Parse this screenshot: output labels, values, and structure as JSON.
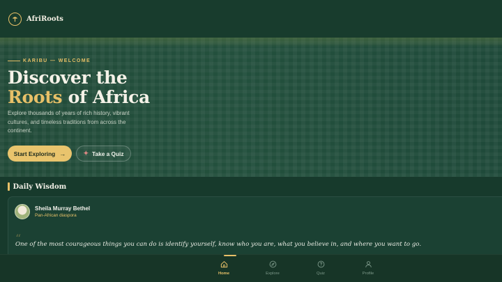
{
  "header": {
    "brand": "AfriRoots",
    "logo_icon": "tree-icon"
  },
  "hero": {
    "eyebrow": "KARIBU — WELCOME",
    "title_line1": "Discover the",
    "title_accent": "Roots",
    "title_rest": " of Africa",
    "subtitle": "Explore thousands of years of rich history, vibrant cultures, and timeless traditions from across the continent.",
    "primary_button": "Start Exploring",
    "primary_icon": "arrow-right-icon",
    "secondary_button": "Take a Quiz",
    "secondary_icon": "sparkle-icon"
  },
  "wisdom": {
    "section_title": "Daily Wisdom",
    "author": "Sheila Murray Bethel",
    "author_tag": "Pan-African diaspora",
    "quote_mark": "“",
    "quote": "One of the most courageous things you can do is identify yourself, know who you are, what you believe in, and where you want to go."
  },
  "nav": {
    "items": [
      {
        "label": "Home",
        "icon": "home-icon",
        "active": true
      },
      {
        "label": "Explore",
        "icon": "compass-icon",
        "active": false
      },
      {
        "label": "Quiz",
        "icon": "question-icon",
        "active": false
      },
      {
        "label": "Profile",
        "icon": "user-icon",
        "active": false
      }
    ]
  },
  "colors": {
    "accent": "#e7c068",
    "background": "#173a2c"
  }
}
